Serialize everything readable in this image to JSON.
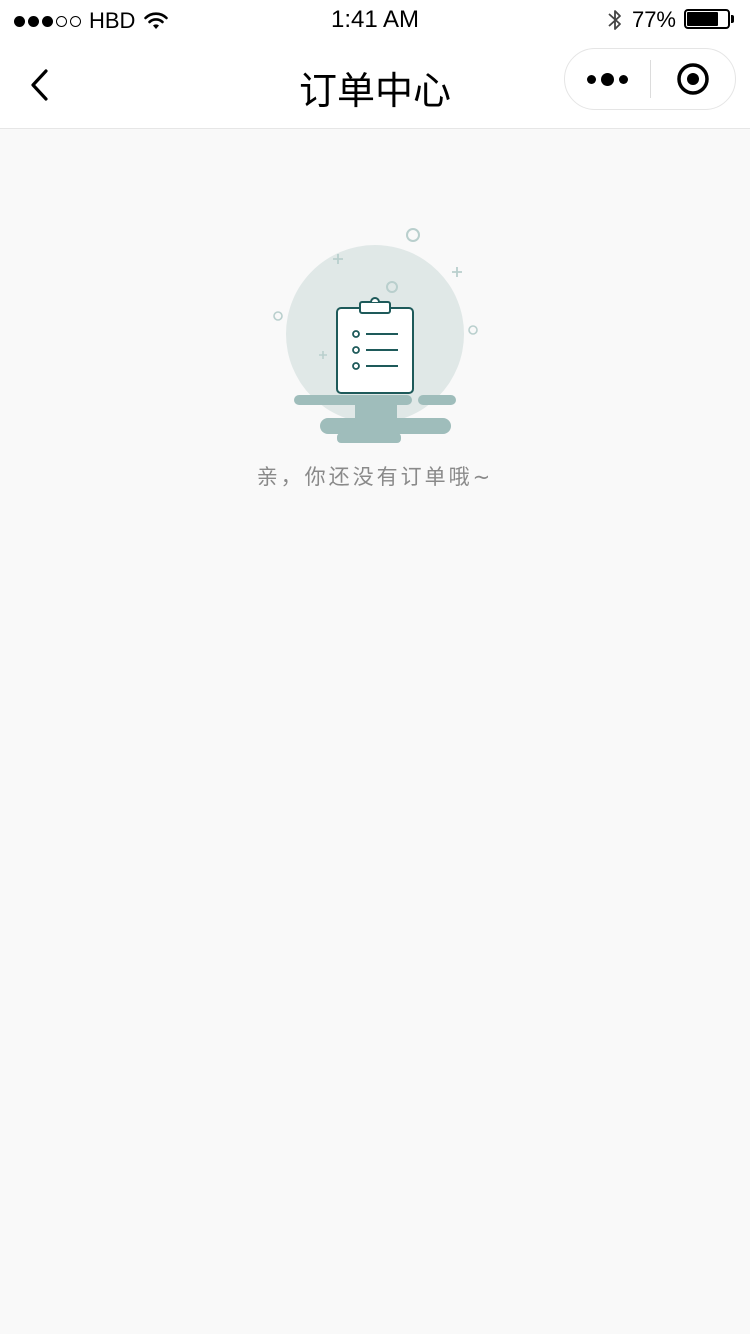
{
  "status_bar": {
    "carrier": "HBD",
    "time": "1:41 AM",
    "battery_percent": "77%",
    "battery_level": 0.77,
    "signal_bars_filled": 3,
    "signal_bars_total": 5,
    "icons": [
      "wifi-icon",
      "bluetooth-icon",
      "battery-icon"
    ]
  },
  "nav": {
    "title": "订单中心",
    "back_icon": "chevron-left-icon",
    "capsule_icons": [
      "more-icon",
      "close-target-icon"
    ]
  },
  "empty_state": {
    "message": "亲，你还没有订单哦~",
    "illustration_icon": "clipboard-icon",
    "colors": {
      "circle": "#e0e8e7",
      "clipboard_stroke": "#1e5a5a",
      "clouds": "#9fbdbb",
      "sparkles": "#b9cfcd"
    }
  }
}
